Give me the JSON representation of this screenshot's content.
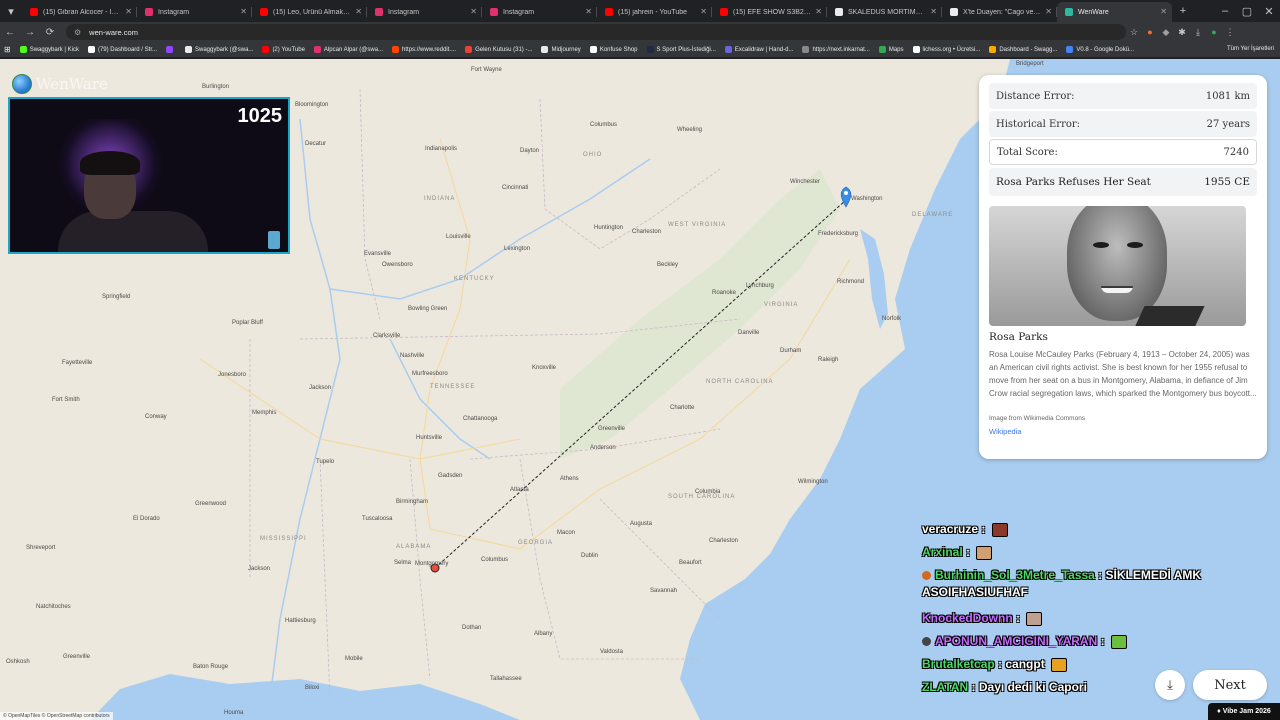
{
  "browser": {
    "tabs": [
      {
        "title": "(15) Gibran Alcocer - Idea 10",
        "color": "#ff0000"
      },
      {
        "title": "Instagram",
        "color": "#e1306c"
      },
      {
        "title": "(15) Leo, Ürünü Almak İçin Mi...",
        "color": "#ff0000"
      },
      {
        "title": "Instagram",
        "color": "#e1306c"
      },
      {
        "title": "Instagram",
        "color": "#e1306c"
      },
      {
        "title": "(15) jahrein - YouTube",
        "color": "#ff0000"
      },
      {
        "title": "(15) EFE SHOW S3B26 | MÖSY...",
        "color": "#ff0000"
      },
      {
        "title": "SKALEDUS MORTIMAS Toplul...",
        "color": "#e8eaed"
      },
      {
        "title": "X'te Duayen: \"Cago vergi mü...",
        "color": "#e8eaed"
      },
      {
        "title": "WenWare",
        "color": "#2fb8a0"
      }
    ],
    "url": "wen-ware.com",
    "bookmarks": [
      {
        "label": "Swaggybark | Kick",
        "color": "#53fc18"
      },
      {
        "label": "(79) Dashboard / Str...",
        "color": "#ffffff"
      },
      {
        "label": "",
        "color": "#9146ff"
      },
      {
        "label": "Swaggybark (@swa...",
        "color": "#e8eaed"
      },
      {
        "label": "(2) YouTube",
        "color": "#ff0000"
      },
      {
        "label": "Alpcan Alpar (@swa...",
        "color": "#e1306c"
      },
      {
        "label": "https://www.reddit....",
        "color": "#ff4500"
      },
      {
        "label": "Gelen Kutusu (31) -...",
        "color": "#ea4335"
      },
      {
        "label": "Midjourney",
        "color": "#e8eaed"
      },
      {
        "label": "Konfuse Shop",
        "color": "#ffffff"
      },
      {
        "label": "S Sport Plus-İstediği...",
        "color": "#1f2a44"
      },
      {
        "label": "Excalidraw | Hand-d...",
        "color": "#6965db"
      },
      {
        "label": "https://next.inkarnat...",
        "color": "#888888"
      },
      {
        "label": "Maps",
        "color": "#34a853"
      },
      {
        "label": "lichess.org • Ücretsi...",
        "color": "#ffffff"
      },
      {
        "label": "Dashboard - Swagg...",
        "color": "#f9ab00"
      },
      {
        "label": "V0.8 - Google Dokü...",
        "color": "#4285f4"
      }
    ],
    "all_bookmarks": "Tüm Yer İşaretleri"
  },
  "brand": "WenWare",
  "webcam": {
    "score": "1025"
  },
  "map": {
    "cities": [
      "Fort Wayne",
      "Burlington",
      "Bloomington",
      "Decatur",
      "Indianapolis",
      "Dayton",
      "Columbus",
      "Wheeling",
      "Cincinnati",
      "Winchester",
      "Washington",
      "Fredericksburg",
      "Louisville",
      "Lexington",
      "Huntington",
      "Charleston",
      "Evansville",
      "Owensboro",
      "Beckley",
      "Roanoke",
      "Lynchburg",
      "Springfield",
      "Poplar Bluff",
      "Bowling Green",
      "Richmond",
      "Norfolk",
      "Clarksville",
      "Danville",
      "Nashville",
      "Knoxville",
      "Murfreesboro",
      "Durham",
      "Raleigh",
      "Jonesboro",
      "Jackson",
      "Fayetteville",
      "Fort Smith",
      "Memphis",
      "Conway",
      "Chattanooga",
      "Charlotte",
      "Huntsville",
      "Greenville",
      "Anderson",
      "Tupelo",
      "Gadsden",
      "Atlanta",
      "Athens",
      "El Dorado",
      "Birmingham",
      "Tuscaloosa",
      "Columbia",
      "Greenwood",
      "Wilmington",
      "Shreveport",
      "Jackson",
      "Selma",
      "Montgomery",
      "Columbus",
      "Macon",
      "Dublin",
      "Augusta",
      "Charleston",
      "Beaufort",
      "Savannah",
      "Natchitoches",
      "Hattiesburg",
      "Dothan",
      "Albany",
      "Valdosta",
      "Baton Rouge",
      "Mobile",
      "Tallahassee",
      "Biloxi",
      "Houma",
      "Bridgeport",
      "Greenville",
      "Oshkosh"
    ],
    "states": [
      "OHIO",
      "INDIANA",
      "WEST VIRGINIA",
      "KENTUCKY",
      "VIRGINIA",
      "TENNESSEE",
      "NORTH CAROLINA",
      "SOUTH CAROLINA",
      "GEORGIA",
      "ALABAMA",
      "MISSISSIPPI",
      "DELAWARE"
    ],
    "attribution": "© OpenMapTiles © OpenStreetMap contributors"
  },
  "result": {
    "distance_label": "Distance Error:",
    "distance_value": "1081 km",
    "historical_label": "Historical Error:",
    "historical_value": "27 years",
    "total_label": "Total Score:",
    "total_value": "7240",
    "event_title": "Rosa Parks Refuses Her Seat",
    "event_year": "1955 CE",
    "wiki_title": "Rosa Parks",
    "wiki_text": "Rosa Louise McCauley Parks (February 4, 1913 – October 24, 2005) was an American civil rights activist. She is best known for her 1955 refusal to move from her seat on a bus in Montgomery, Alabama, in defiance of Jim Crow racial segregation laws, which sparked the Montgomery bus boycott...",
    "wiki_credit": "Image from Wikimedia Commons",
    "wiki_link": "Wikipedia"
  },
  "chat": [
    {
      "user": "veracruze",
      "user_color": "#ffffff",
      "text": "",
      "emote": "#8b3a2a"
    },
    {
      "user": "Arxinal",
      "user_color": "#4cd964",
      "text": "",
      "emote": "#d0a070"
    },
    {
      "user": "Burhinin_Sol_3Metre_Tassa",
      "user_color": "#4cd964",
      "text": "SİKLEMEDİ AMK ASOIFHASIUFHAF",
      "badge": "#d2691e"
    },
    {
      "user": "KnockedDownn",
      "user_color": "#c76bff",
      "text": "",
      "emote": "#c0a090"
    },
    {
      "user": "APONUN_AMCIGINI_YARAN",
      "user_color": "#c76bff",
      "text": "",
      "emote": "#6abf3c",
      "badge": "#444444"
    },
    {
      "user": "Brutalketcap",
      "user_color": "#4cd964",
      "text": "cangpt",
      "emote": "#e8a020"
    },
    {
      "user": "ZLATAN",
      "user_color": "#4cd964",
      "text": "Dayı dedi ki Capori"
    }
  ],
  "buttons": {
    "next": "Next",
    "vibe_jam": "♦ Vibe Jam 2026"
  }
}
